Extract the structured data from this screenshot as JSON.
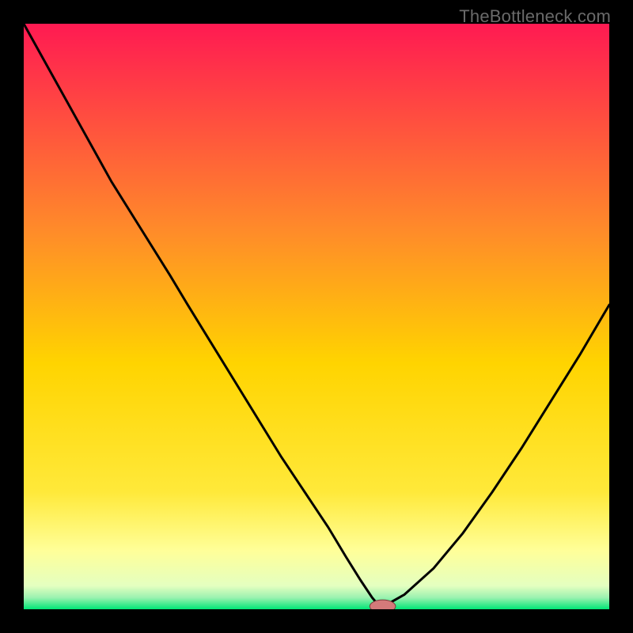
{
  "watermark": "TheBottleneck.com",
  "colors": {
    "background": "#000000",
    "gradient_top": "#ff1a52",
    "gradient_upper_mid": "#ff8a2a",
    "gradient_mid": "#ffd400",
    "gradient_lower": "#ffff99",
    "gradient_bottom": "#00e676",
    "curve": "#000000",
    "marker_fill": "#d47a7a",
    "marker_stroke": "#7a3b3b"
  },
  "chart_data": {
    "type": "line",
    "title": "",
    "xlabel": "",
    "ylabel": "",
    "xlim": [
      0,
      100
    ],
    "ylim": [
      0,
      100
    ],
    "x": [
      0,
      5,
      10,
      15,
      20,
      25,
      28,
      32,
      36,
      40,
      44,
      48,
      52,
      55,
      57.5,
      59.5,
      60.5,
      62,
      65,
      70,
      75,
      80,
      85,
      90,
      95,
      100
    ],
    "values": [
      100,
      91,
      82,
      73,
      65,
      57,
      52,
      45.5,
      39,
      32.5,
      26,
      20,
      14,
      9,
      5,
      2,
      0.8,
      0.8,
      2.5,
      7,
      13,
      20,
      27.5,
      35.5,
      43.5,
      52
    ],
    "marker": {
      "x": 61.3,
      "y": 0.5,
      "rx": 2.2,
      "ry": 1.1
    }
  }
}
